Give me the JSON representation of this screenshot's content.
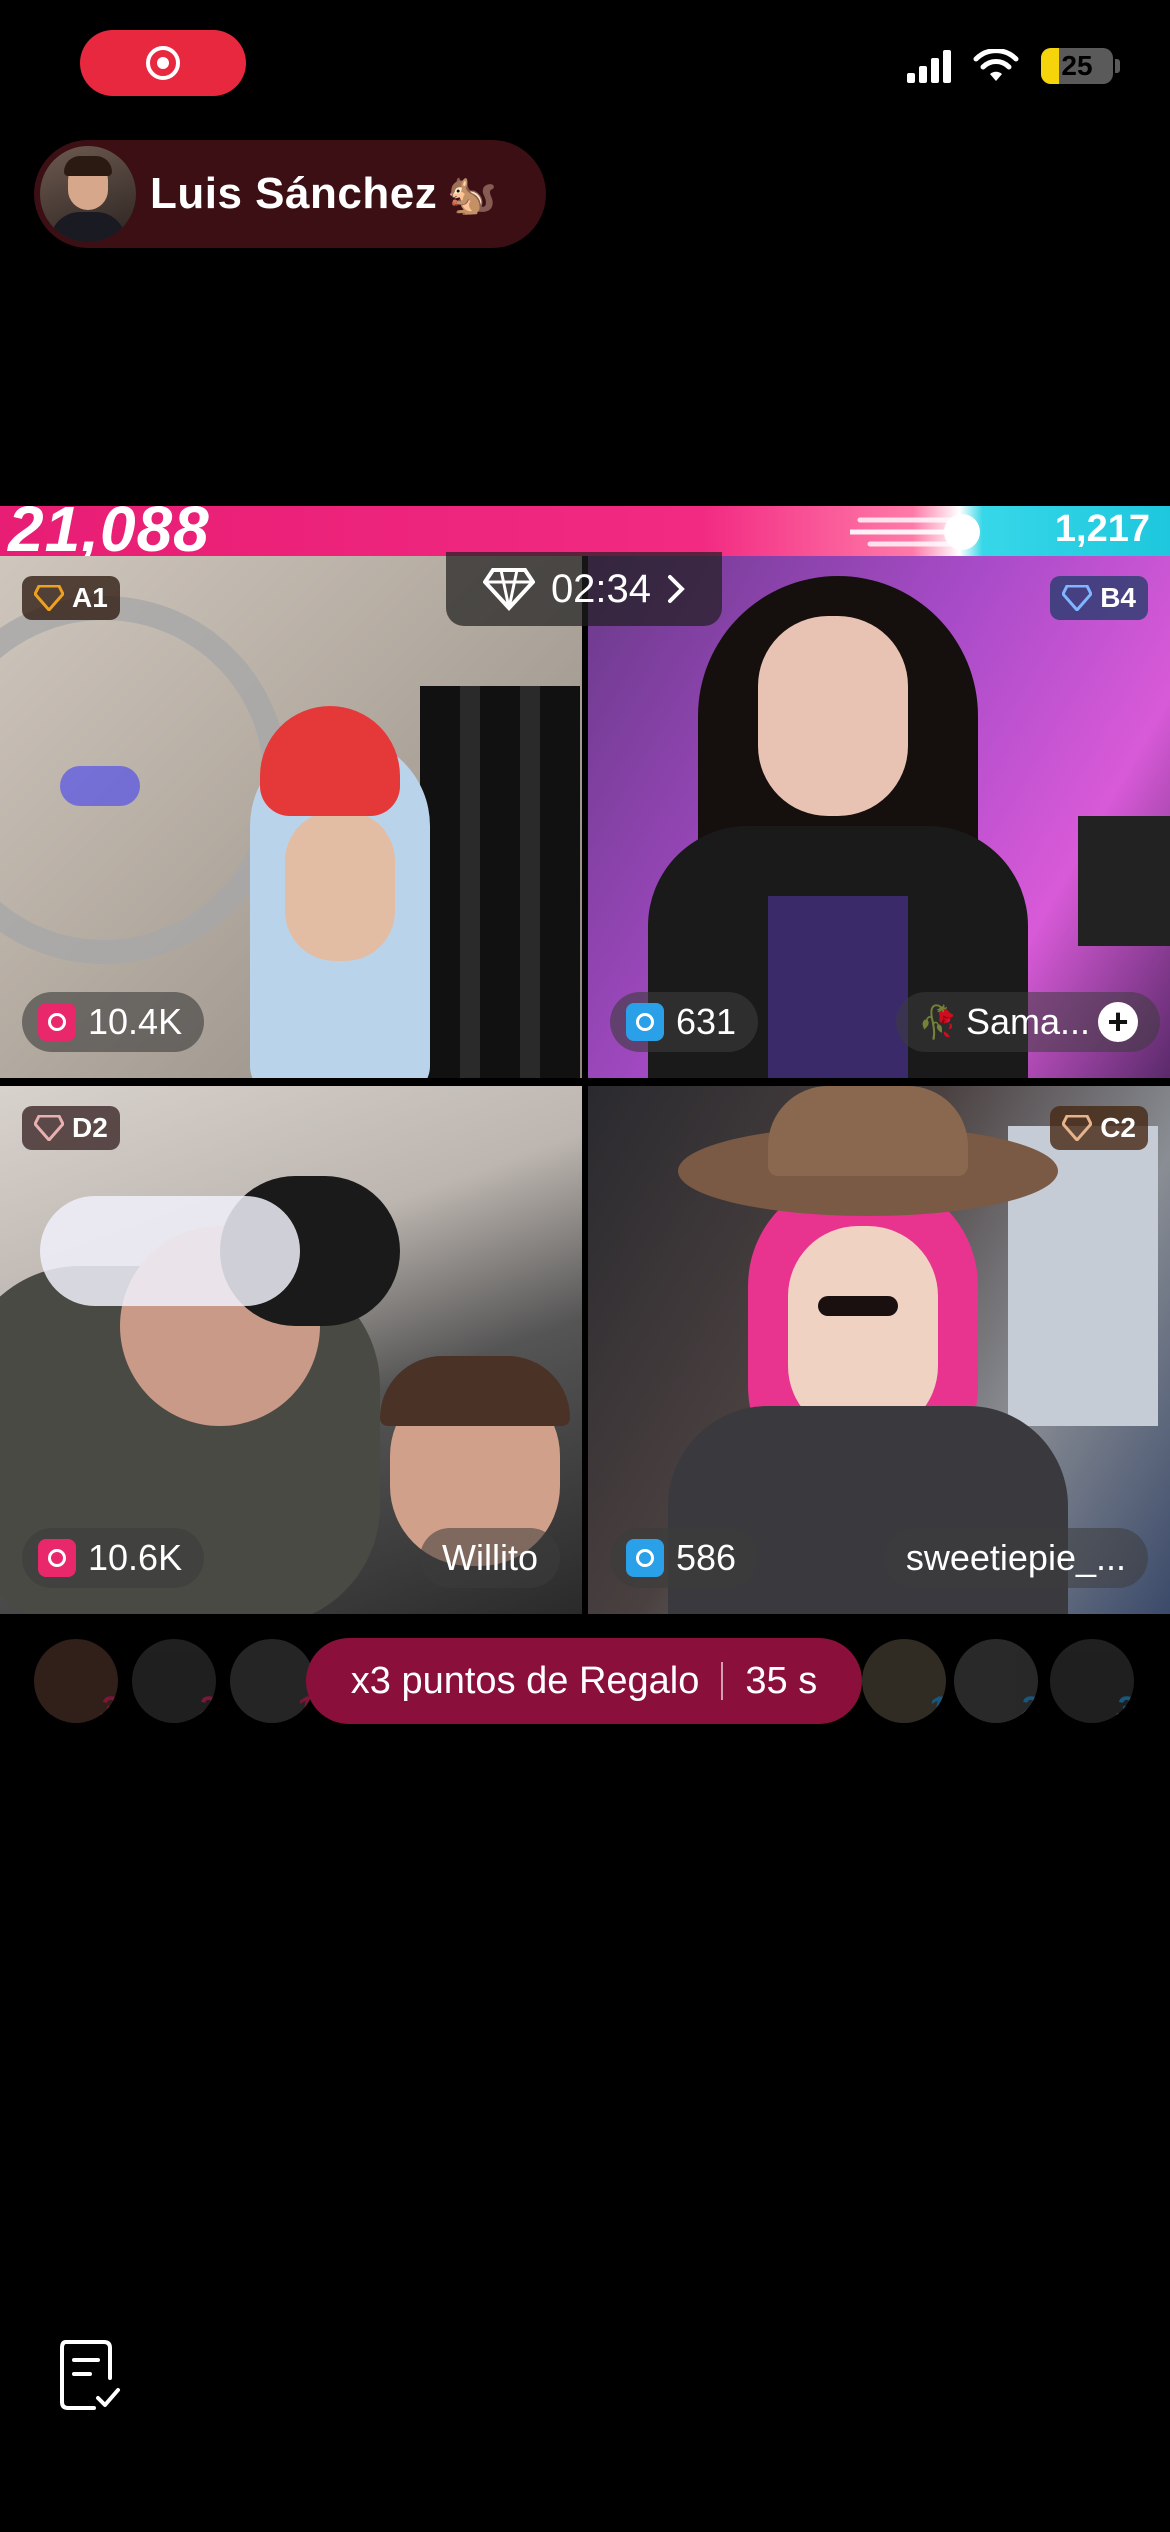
{
  "status_bar": {
    "battery": "25",
    "battery_level": 0.25
  },
  "host": {
    "name": "Luis Sánchez",
    "emoji": "🐿️"
  },
  "battle": {
    "score_left": "21,088",
    "score_right": "1,217",
    "timer": "02:34",
    "left_color": "#e81d74",
    "right_color": "#1ec7dd"
  },
  "players": [
    {
      "badge": "A1",
      "points": "10.4K",
      "name": "",
      "team_color": "#e8286b",
      "badge_color": "#f0a020"
    },
    {
      "badge": "B4",
      "points": "631",
      "name": "Sama...",
      "team_color": "#2aa0e8",
      "badge_color": "#7fb6ff"
    },
    {
      "badge": "D2",
      "points": "10.6K",
      "name": "Willito",
      "team_color": "#e8286b",
      "badge_color": "#e8b0b0"
    },
    {
      "badge": "C2",
      "points": "586",
      "name": "sweetiepie_...",
      "team_color": "#2aa0e8",
      "badge_color": "#e6b38a"
    }
  ],
  "bonus": {
    "label": "x3 puntos de Regalo",
    "countdown": "35 s"
  },
  "left_ranks": [
    "3",
    "2",
    "1"
  ],
  "right_ranks": [
    "1",
    "2",
    "3"
  ],
  "icons": {
    "record": "record-icon",
    "signal": "signal-icon",
    "wifi": "wifi-icon",
    "diamond": "diamond-icon",
    "gift": "gift-icon",
    "doc": "document-check-icon"
  }
}
